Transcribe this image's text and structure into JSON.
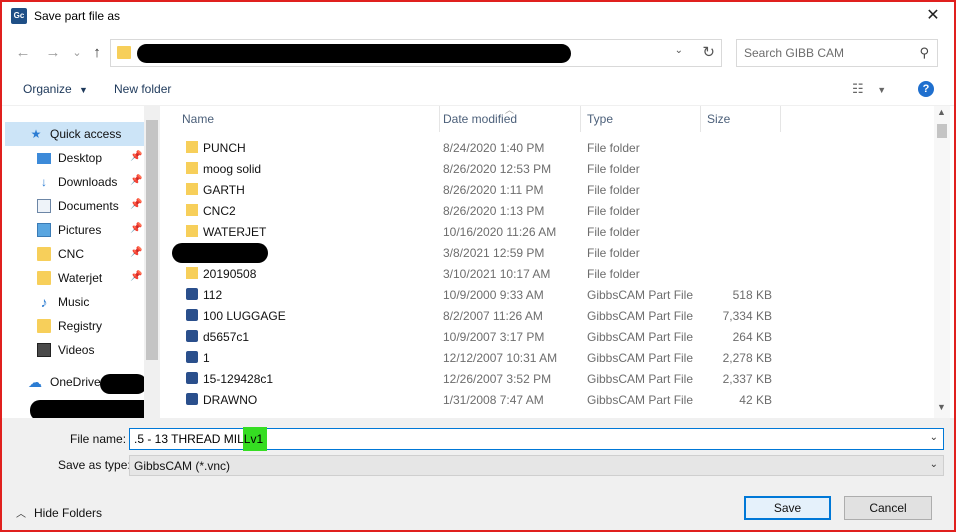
{
  "window": {
    "title": "Save part file as",
    "app_icon_text": "Gc",
    "border_color": "#e0201e"
  },
  "nav": {
    "back_icon": "arrow-left-icon",
    "forward_icon": "arrow-right-icon",
    "up_icon": "arrow-up-icon",
    "refresh_icon": "refresh-icon"
  },
  "search": {
    "placeholder": "Search GIBB CAM"
  },
  "toolbar": {
    "organize_label": "Organize",
    "new_folder_label": "New folder"
  },
  "sidebar": {
    "items": [
      {
        "label": "Quick access",
        "icon": "star-icon",
        "pinned": false
      },
      {
        "label": "Desktop",
        "icon": "desktop-icon",
        "pinned": true
      },
      {
        "label": "Downloads",
        "icon": "download-icon",
        "pinned": true
      },
      {
        "label": "Documents",
        "icon": "document-icon",
        "pinned": true
      },
      {
        "label": "Pictures",
        "icon": "picture-icon",
        "pinned": true
      },
      {
        "label": "CNC",
        "icon": "folder-icon",
        "pinned": true
      },
      {
        "label": "Waterjet",
        "icon": "folder-icon",
        "pinned": true
      },
      {
        "label": "Music",
        "icon": "music-icon",
        "pinned": false
      },
      {
        "label": "Registry",
        "icon": "folder-icon",
        "pinned": false
      },
      {
        "label": "Videos",
        "icon": "video-icon",
        "pinned": false
      },
      {
        "label": "OneDrive",
        "icon": "cloud-icon",
        "pinned": false
      }
    ]
  },
  "columns": {
    "name": "Name",
    "date": "Date modified",
    "type": "Type",
    "size": "Size"
  },
  "files": [
    {
      "name": "PUNCH",
      "date": "8/24/2020 1:40 PM",
      "type": "File folder",
      "size": "",
      "kind": "folder"
    },
    {
      "name": "moog solid",
      "date": "8/26/2020 12:53 PM",
      "type": "File folder",
      "size": "",
      "kind": "folder"
    },
    {
      "name": "GARTH",
      "date": "8/26/2020 1:11 PM",
      "type": "File folder",
      "size": "",
      "kind": "folder"
    },
    {
      "name": "CNC2",
      "date": "8/26/2020 1:13 PM",
      "type": "File folder",
      "size": "",
      "kind": "folder"
    },
    {
      "name": "WATERJET",
      "date": "10/16/2020 11:26 AM",
      "type": "File folder",
      "size": "",
      "kind": "folder"
    },
    {
      "name": "",
      "date": "3/8/2021 12:59 PM",
      "type": "File folder",
      "size": "",
      "kind": "redacted"
    },
    {
      "name": "20190508",
      "date": "3/10/2021 10:17 AM",
      "type": "File folder",
      "size": "",
      "kind": "folder"
    },
    {
      "name": "112",
      "date": "10/9/2000 9:33 AM",
      "type": "GibbsCAM Part File",
      "size": "518 KB",
      "kind": "part"
    },
    {
      "name": "100 LUGGAGE",
      "date": "8/2/2007 11:26 AM",
      "type": "GibbsCAM Part File",
      "size": "7,334 KB",
      "kind": "part"
    },
    {
      "name": "d5657c1",
      "date": "10/9/2007 3:17 PM",
      "type": "GibbsCAM Part File",
      "size": "264 KB",
      "kind": "part"
    },
    {
      "name": "1",
      "date": "12/12/2007 10:31 AM",
      "type": "GibbsCAM Part File",
      "size": "2,278 KB",
      "kind": "part"
    },
    {
      "name": "15-129428c1",
      "date": "12/26/2007 3:52 PM",
      "type": "GibbsCAM Part File",
      "size": "2,337 KB",
      "kind": "part"
    },
    {
      "name": "DRAWNO",
      "date": "1/31/2008 7:47 AM",
      "type": "GibbsCAM Part File",
      "size": "42 KB",
      "kind": "part"
    }
  ],
  "form": {
    "filename_label": "File name:",
    "filename_value": ".5 - 13 THREAD MILLv1",
    "savetype_label": "Save as type:",
    "savetype_value": "GibbsCAM (*.vnc)"
  },
  "footer": {
    "hide_folders_label": "Hide Folders",
    "save_label": "Save",
    "cancel_label": "Cancel"
  }
}
